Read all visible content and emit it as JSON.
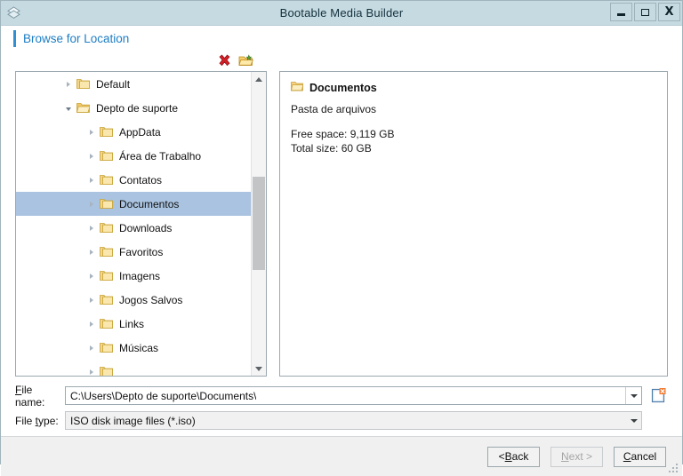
{
  "window": {
    "title": "Bootable Media Builder",
    "app_icon": "diamond-logo-icon",
    "controls": {
      "minimize": "minimize-icon",
      "maximize": "maximize-icon",
      "close": "X"
    }
  },
  "header": {
    "title": "Browse for Location",
    "accent_color": "#2f8fd0",
    "text_color": "#1d7ec4"
  },
  "toolbar": {
    "delete_icon": "red-x-delete-icon",
    "new_folder_icon": "new-folder-icon"
  },
  "tree": {
    "items": [
      {
        "label": "Default",
        "depth": 2,
        "expander": "collapsed",
        "folder": "closed",
        "selected": false
      },
      {
        "label": "Depto de suporte",
        "depth": 2,
        "expander": "expanded",
        "folder": "open",
        "selected": false
      },
      {
        "label": "AppData",
        "depth": 3,
        "expander": "collapsed",
        "folder": "closed",
        "selected": false
      },
      {
        "label": "Área de Trabalho",
        "depth": 3,
        "expander": "collapsed",
        "folder": "closed",
        "selected": false
      },
      {
        "label": "Contatos",
        "depth": 3,
        "expander": "collapsed",
        "folder": "closed",
        "selected": false
      },
      {
        "label": "Documentos",
        "depth": 3,
        "expander": "collapsed",
        "folder": "closed",
        "selected": true
      },
      {
        "label": "Downloads",
        "depth": 3,
        "expander": "collapsed",
        "folder": "closed",
        "selected": false
      },
      {
        "label": "Favoritos",
        "depth": 3,
        "expander": "collapsed",
        "folder": "closed",
        "selected": false
      },
      {
        "label": "Imagens",
        "depth": 3,
        "expander": "collapsed",
        "folder": "closed",
        "selected": false
      },
      {
        "label": "Jogos Salvos",
        "depth": 3,
        "expander": "collapsed",
        "folder": "closed",
        "selected": false
      },
      {
        "label": "Links",
        "depth": 3,
        "expander": "collapsed",
        "folder": "closed",
        "selected": false
      },
      {
        "label": "Músicas",
        "depth": 3,
        "expander": "collapsed",
        "folder": "closed",
        "selected": false
      },
      {
        "label": "",
        "depth": 3,
        "expander": "collapsed",
        "folder": "closed",
        "selected": false
      }
    ],
    "selection_color": "#a9c3e0",
    "scrollbar": {
      "up_icon": "chevron-up-icon",
      "down_icon": "chevron-down-icon"
    }
  },
  "details": {
    "name": "Documentos",
    "folder_icon": "folder-icon",
    "type": "Pasta de arquivos",
    "free_space": "Free space: 9,119 GB",
    "total_size": "Total size: 60 GB"
  },
  "fields": {
    "file_name": {
      "label_prefix": "",
      "label_acc": "F",
      "label_suffix": "ile name:",
      "value": "C:\\Users\\Depto de suporte\\Documents\\",
      "dropdown_icon": "chevron-down-icon"
    },
    "file_type": {
      "label_prefix": "File ",
      "label_acc": "t",
      "label_suffix": "ype:",
      "value": "ISO disk image files (*.iso)",
      "dropdown_icon": "chevron-down-icon"
    },
    "new_file_button": "new-file-icon"
  },
  "footer": {
    "back": {
      "prefix": "< ",
      "acc": "B",
      "suffix": "ack",
      "disabled": false
    },
    "next": {
      "prefix": "",
      "acc": "N",
      "suffix": "ext >",
      "disabled": true
    },
    "cancel": {
      "prefix": "",
      "acc": "C",
      "suffix": "ancel",
      "disabled": false
    },
    "resize_grip": "resize-grip-icon"
  }
}
